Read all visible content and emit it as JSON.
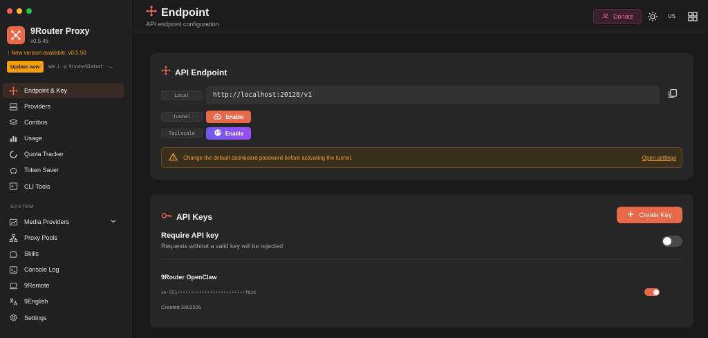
{
  "sidebar": {
    "brand_title": "9Router Proxy",
    "version": "v0.5.45",
    "update_notice": "↑ New version available: v0.5.50",
    "update_button": "Update now",
    "update_command": "npm i -g 9router@latest --…",
    "items": [
      {
        "label": "Endpoint & Key",
        "icon": "endpoint-icon",
        "active": true
      },
      {
        "label": "Providers",
        "icon": "server-icon"
      },
      {
        "label": "Combos",
        "icon": "layers-icon"
      },
      {
        "label": "Usage",
        "icon": "bar-chart-icon"
      },
      {
        "label": "Quota Tracker",
        "icon": "gauge-icon"
      },
      {
        "label": "Token Saver",
        "icon": "piggy-bank-icon"
      },
      {
        "label": "CLI Tools",
        "icon": "terminal-icon"
      }
    ],
    "section_label": "SYSTEM",
    "system_items": [
      {
        "label": "Media Providers",
        "icon": "media-icon"
      },
      {
        "label": "Proxy Pools",
        "icon": "network-icon"
      },
      {
        "label": "Skills",
        "icon": "puzzle-icon"
      },
      {
        "label": "Console Log",
        "icon": "console-icon"
      },
      {
        "label": "9Remote",
        "icon": "laptop-icon"
      },
      {
        "label": "9English",
        "icon": "translate-icon"
      },
      {
        "label": "Settings",
        "icon": "gear-icon"
      }
    ]
  },
  "header": {
    "title": "Endpoint",
    "subtitle": "API endpoint configuration",
    "donate_label": "Donate",
    "language": "US"
  },
  "endpoint_card": {
    "title": "API Endpoint",
    "local_label": "Local",
    "local_url": "http://localhost:20128/v1",
    "tunnel_label": "Tunnel",
    "tunnel_button": "Enable",
    "tailscale_label": "Tailscale",
    "tailscale_button": "Enable",
    "warning_text": "Change the default dashboard password before activating the tunnel.",
    "warning_link": "Open settings"
  },
  "keys_card": {
    "title": "API Keys",
    "create_button": "Create Key",
    "require_title": "Require API key",
    "require_desc": "Requests without a valid key will be rejected",
    "require_enabled": false,
    "key_name": "9Router OpenClaw",
    "key_value": "sk-551•••••••••••••••••••••••••f83d",
    "key_created": "Created 3/8/2026",
    "key_enabled": true
  },
  "colors": {
    "accent": "#e8684a",
    "warning": "#f0a030",
    "donate": "#f06292",
    "update": "#f59e0b"
  }
}
